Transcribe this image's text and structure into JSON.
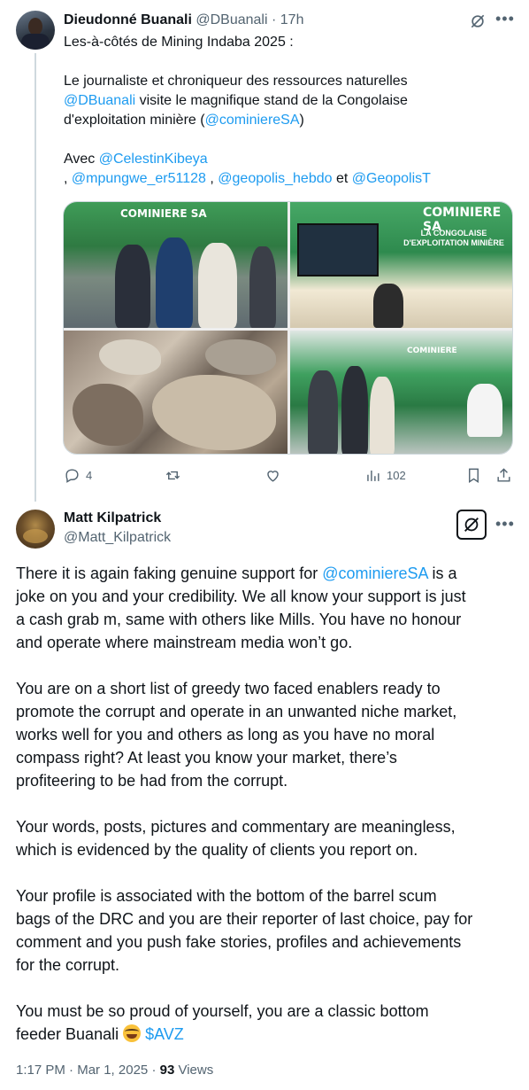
{
  "tweet1": {
    "author_name": "Dieudonné Buanali",
    "author_handle": "@DBuanali",
    "separator": "·",
    "time": "17h",
    "lines": {
      "l1": "Les-à-côtés de Mining Indaba 2025 :",
      "l2": "Le journaliste et chroniqueur des ressources naturelles",
      "l3_link": "@DBuanali",
      "l3_rest": " visite le magnifique stand de la Congolaise",
      "l4_start": "d'exploitation minière (",
      "l4_link": "@cominiereSA",
      "l4_end": ")",
      "l5_start": "Avec ",
      "l5_link": "@CelestinKibeya",
      "l6_a": ", ",
      "l6_link1": "@mpungwe_er51128",
      "l6_b": " , ",
      "l6_link2": "@geopolis_hebdo",
      "l6_c": "  et ",
      "l6_link3": "@GeopolisT"
    },
    "photo_texts": {
      "p1": "COMINIERE SA",
      "p2": "COMINIERE SA",
      "p2_sub": "LA CONGOLAISE D'EXPLOITATION MINIÈRE",
      "p4": "COMINIERE"
    },
    "stats": {
      "replies": "4",
      "reposts": "",
      "likes": "",
      "views": "102"
    }
  },
  "tweet2": {
    "author_name": "Matt Kilpatrick",
    "author_handle": "@Matt_Kilpatrick",
    "p1_l1_a": "There it is again faking genuine support for ",
    "p1_l1_link": "@cominiereSA",
    "p1_l1_b": " is a",
    "p1_l2": "joke on you and your credibility. We all know your support is just",
    "p1_l3": "a cash grab m, same with others like Mills. You have no honour",
    "p1_l4": "and operate where mainstream media won’t go.",
    "p2_l1": "You are on a short list of greedy two faced enablers ready to",
    "p2_l2": "promote the corrupt and operate in an unwanted niche market,",
    "p2_l3": "works well for you and others as long as you have no moral",
    "p2_l4": "compass right? At least you know your market, there’s",
    "p2_l5": "profiteering to be had from the corrupt.",
    "p3_l1": "Your words, posts, pictures and commentary are meaningless,",
    "p3_l2": "which is evidenced by the quality of clients you report on.",
    "p4_l1": "Your profile is associated with the bottom of the barrel scum",
    "p4_l2": "bags of the DRC and you are their reporter of last choice, pay for",
    "p4_l3": "comment and you  push fake stories, profiles and achievements",
    "p4_l4": "for the corrupt.",
    "p5_l1": "You must be so proud of yourself, you are a classic bottom",
    "p5_l2_a": "feeder Buanali ",
    "p5_l2_cashtag": "$AVZ",
    "time": "1:17 PM",
    "separator": "·",
    "date": "Mar 1, 2025",
    "views_count": "93",
    "views_label": "Views"
  }
}
